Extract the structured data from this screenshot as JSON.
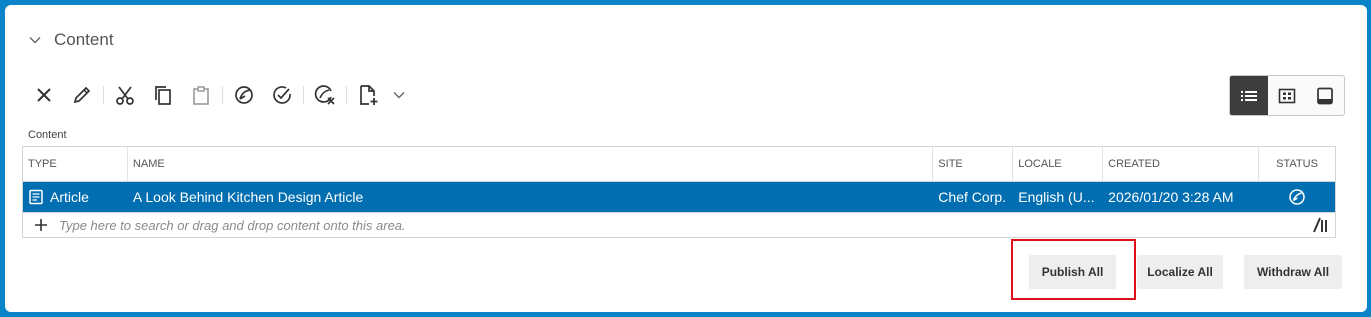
{
  "section": {
    "title": "Content"
  },
  "toolbar": {
    "icons": [
      "close-icon",
      "edit-icon",
      "cut-icon",
      "copy-icon",
      "paste-icon",
      "publish-icon",
      "approve-icon",
      "withdraw-icon",
      "new-document-icon",
      "chevron-down-icon"
    ]
  },
  "view_switch": {
    "active": "list-view",
    "options": [
      "list-view",
      "thumbnail-view",
      "preview-view"
    ]
  },
  "list_caption": "Content",
  "table": {
    "headers": {
      "type": "TYPE",
      "name": "NAME",
      "site": "SITE",
      "locale": "LOCALE",
      "created": "CREATED",
      "status": "STATUS"
    },
    "rows": [
      {
        "type": "Article",
        "name": "A Look Behind Kitchen Design Article",
        "site": "Chef Corp.",
        "locale": "English (U...",
        "created": "2026/01/20 3:28 AM",
        "status_icon": "published-icon",
        "selected": true
      }
    ],
    "drop_placeholder": "Type here to search or drag and drop content onto this area."
  },
  "actions": {
    "publish_all": "Publish All",
    "localize_all": "Localize All",
    "withdraw_all": "Withdraw All"
  },
  "colors": {
    "frame": "#0a84c8",
    "selected_row": "#006eb0",
    "highlight": "#e0101b",
    "active_view": "#3d3d3d"
  }
}
